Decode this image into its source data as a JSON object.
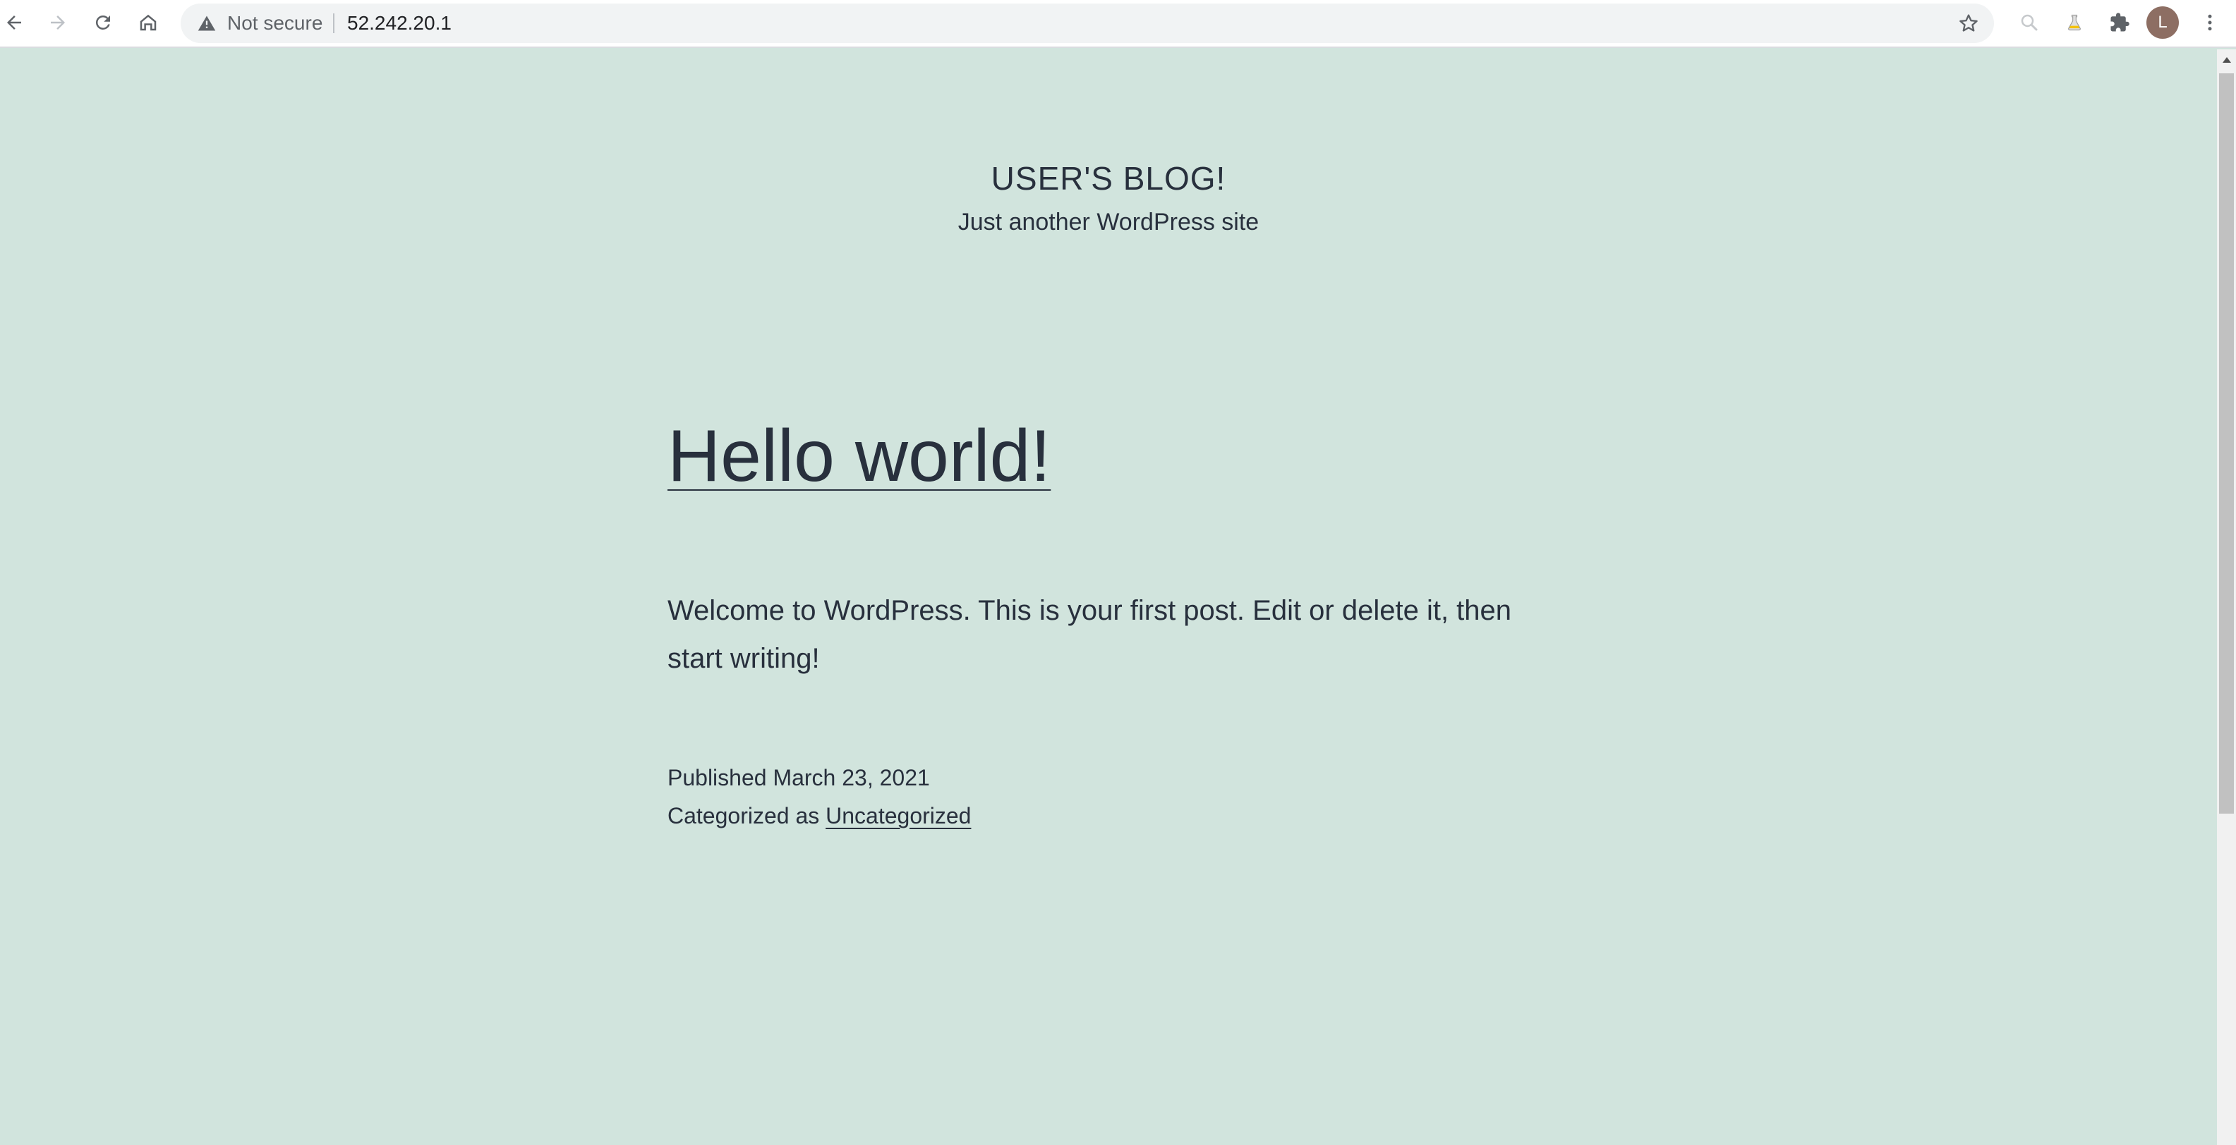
{
  "browser": {
    "security_label": "Not secure",
    "url": "52.242.20.1",
    "avatar_letter": "L",
    "icons": {
      "back": "back-arrow-icon",
      "forward": "forward-arrow-icon",
      "reload": "reload-icon",
      "home": "home-icon",
      "warning": "warning-triangle-icon",
      "bookmark": "star-icon",
      "zoom": "magnifier-icon",
      "extension_flask": "flask-icon",
      "extensions": "puzzle-icon",
      "menu": "kebab-menu-icon"
    }
  },
  "site": {
    "title": "USER'S BLOG!",
    "description": "Just another WordPress site",
    "background_color": "#d1e4dd",
    "text_color": "#28303d"
  },
  "post": {
    "title": "Hello world!",
    "content": "Welcome to WordPress. This is your first post. Edit or delete it, then start writing!",
    "published_label": "Published",
    "published_date": "March 23, 2021",
    "category_label": "Categorized as",
    "category": "Uncategorized"
  }
}
